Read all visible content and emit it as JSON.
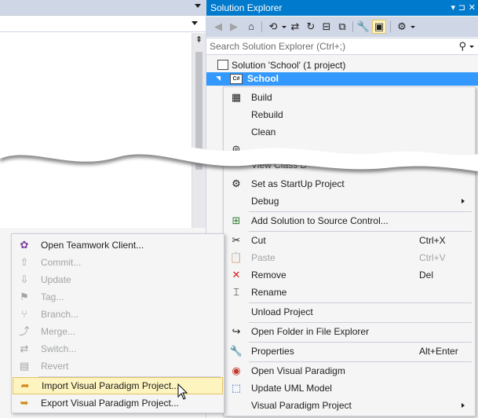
{
  "solution_explorer": {
    "title": "Solution Explorer",
    "title_buttons": {
      "dropdown": "▾",
      "pin": "⊐",
      "close": "✕"
    },
    "toolbar_icons": [
      "back-icon",
      "forward-icon",
      "home-icon",
      "history-icon",
      "sync-icon",
      "collapse-all-icon",
      "show-all-files-icon",
      "properties-icon",
      "preview-icon",
      "scope-icon"
    ],
    "search_placeholder": "Search Solution Explorer (Ctrl+;)",
    "tree": {
      "solution_label": "Solution 'School' (1 project)",
      "project_label": "School",
      "project_icon_text": "C#"
    }
  },
  "context_menu": {
    "items": [
      {
        "label": "Build",
        "icon": "build-icon",
        "glyph": "▦"
      },
      {
        "label": "Rebuild",
        "icon": "",
        "glyph": ""
      },
      {
        "label": "Clean",
        "icon": "",
        "glyph": ""
      },
      {
        "label": "View Class D",
        "icon": "",
        "glyph": ""
      },
      {
        "label": "Set as StartUp Project",
        "icon": "gear-icon",
        "glyph": "⚙"
      },
      {
        "label": "Debug",
        "icon": "",
        "glyph": ""
      },
      {
        "label": "Add Solution to Source Control...",
        "icon": "add-source-control-icon",
        "glyph": "⊞"
      },
      {
        "label": "Cut",
        "shortcut": "Ctrl+X",
        "icon": "scissors-icon",
        "glyph": "✂"
      },
      {
        "label": "Paste",
        "shortcut": "Ctrl+V",
        "icon": "paste-icon",
        "glyph": "📋"
      },
      {
        "label": "Remove",
        "shortcut": "Del",
        "icon": "remove-icon",
        "glyph": "✕"
      },
      {
        "label": "Rename",
        "icon": "rename-icon",
        "glyph": "⌶"
      },
      {
        "label": "Unload Project",
        "icon": "",
        "glyph": ""
      },
      {
        "label": "Open Folder in File Explorer",
        "icon": "open-folder-icon",
        "glyph": "↪"
      },
      {
        "label": "Properties",
        "shortcut": "Alt+Enter",
        "icon": "wrench-icon",
        "glyph": "🔧"
      },
      {
        "label": "Open Visual Paradigm",
        "icon": "visual-paradigm-icon",
        "glyph": "◉"
      },
      {
        "label": "Update UML Model",
        "icon": "update-uml-icon",
        "glyph": "⬚"
      },
      {
        "label": "Visual Paradigm Project",
        "icon": "",
        "glyph": ""
      }
    ],
    "hidden_partial_icon": "⊜"
  },
  "submenu": {
    "items": [
      {
        "label": "Open Teamwork Client...",
        "icon": "teamwork-icon",
        "glyph": "✿"
      },
      {
        "label": "Commit...",
        "icon": "commit-icon",
        "glyph": "⇧"
      },
      {
        "label": "Update",
        "icon": "update-icon",
        "glyph": "⇩"
      },
      {
        "label": "Tag...",
        "icon": "tag-icon",
        "glyph": "⚑"
      },
      {
        "label": "Branch...",
        "icon": "branch-icon",
        "glyph": "⑂"
      },
      {
        "label": "Merge...",
        "icon": "merge-icon",
        "glyph": "⤴"
      },
      {
        "label": "Switch...",
        "icon": "switch-icon",
        "glyph": "⇄"
      },
      {
        "label": "Revert",
        "icon": "revert-icon",
        "glyph": "▤"
      },
      {
        "label": "Import Visual Paradigm Project...",
        "icon": "import-icon",
        "glyph": "➦"
      },
      {
        "label": "Export Visual Paradigm Project...",
        "icon": "export-icon",
        "glyph": "➥"
      }
    ]
  },
  "editor": {
    "splitter_glyph": "⇞"
  },
  "colors": {
    "title_bar": "#007acc",
    "selection": "#3399ff",
    "menu_bg": "#f5f5f5",
    "highlight_bg": "#fdf4bf",
    "highlight_border": "#e5c365",
    "toolbar_bg": "#cfd6e5",
    "remove_icon": "#d32020"
  }
}
